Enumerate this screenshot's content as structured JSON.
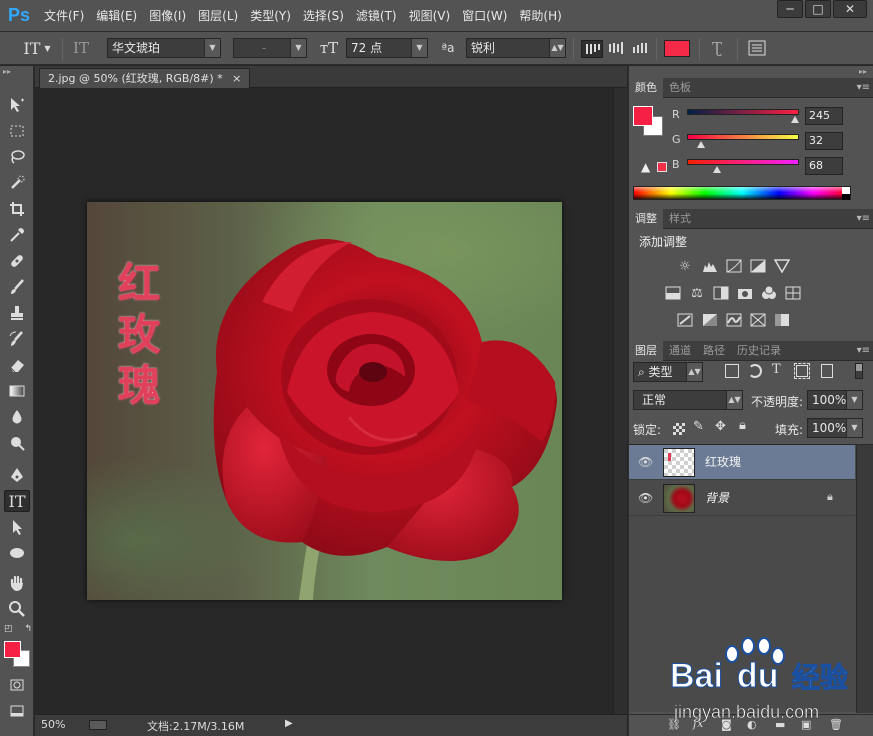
{
  "app": {
    "logo": "Ps",
    "window_controls": [
      "─",
      "□",
      "✕"
    ]
  },
  "menu": [
    "文件(F)",
    "编辑(E)",
    "图像(I)",
    "图层(L)",
    "类型(Y)",
    "选择(S)",
    "滤镜(T)",
    "视图(V)",
    "窗口(W)",
    "帮助(H)"
  ],
  "options": {
    "font_family": "华文琥珀",
    "font_style": "-",
    "font_size": "72 点",
    "aa_label": "ªa",
    "antialias": "锐利",
    "text_color": "#f42a48"
  },
  "document": {
    "tab_title": "2.jpg @ 50% (红玫瑰, RGB/8#) *",
    "zoom": "50%",
    "doc_size": "文档:2.17M/3.16M",
    "text_chars": [
      "红",
      "玫",
      "瑰"
    ]
  },
  "color_panel": {
    "tabs": [
      "颜色",
      "色板"
    ],
    "channels": [
      {
        "label": "R",
        "value": "245",
        "fraction": 0.96
      },
      {
        "label": "G",
        "value": "32",
        "fraction": 0.125
      },
      {
        "label": "B",
        "value": "68",
        "fraction": 0.267
      }
    ],
    "foreground": "#f52044",
    "background": "#ffffff"
  },
  "adjust_panel": {
    "tabs": [
      "调整",
      "样式"
    ],
    "heading": "添加调整"
  },
  "layers_panel": {
    "tabs": [
      "图层",
      "通道",
      "路径",
      "历史记录"
    ],
    "filter": "类型",
    "blend_mode": "正常",
    "opacity_label": "不透明度:",
    "opacity": "100%",
    "lock_label": "锁定:",
    "fill_label": "填充:",
    "fill": "100%",
    "layers": [
      {
        "name": "红玫瑰",
        "selected": true
      },
      {
        "name": "背景",
        "selected": false
      }
    ]
  },
  "watermark": {
    "brand": "Bai",
    "brand2": "du",
    "cn": "经验",
    "url": "jingyan.baidu.com"
  }
}
